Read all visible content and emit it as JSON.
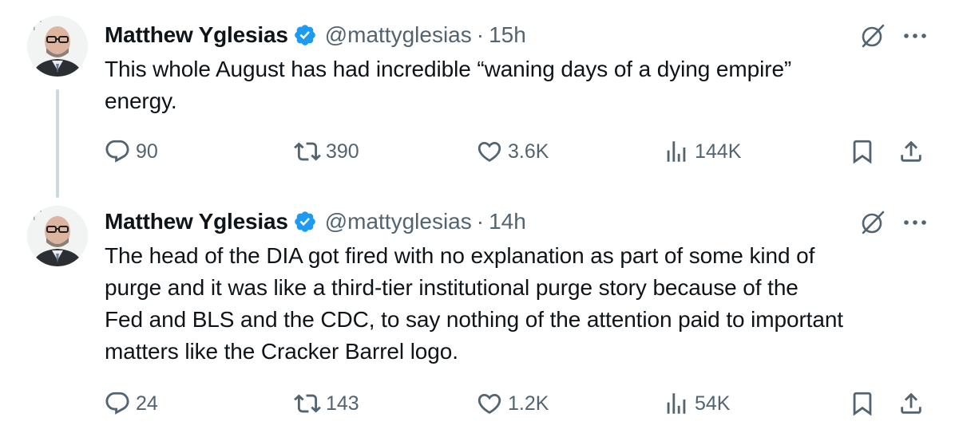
{
  "tweets": [
    {
      "author": {
        "name": "Matthew Yglesias",
        "handle": "@mattyglesias"
      },
      "separator": "·",
      "time": "15h",
      "text_lines": [
        "This whole August has had incredible “waning days of a dying empire”",
        "energy."
      ],
      "stats": {
        "replies": "90",
        "retweets": "390",
        "likes": "3.6K",
        "views": "144K"
      }
    },
    {
      "author": {
        "name": "Matthew Yglesias",
        "handle": "@mattyglesias"
      },
      "separator": "·",
      "time": "14h",
      "text_lines": [
        "The head of the DIA got fired with no explanation as part of some kind of",
        "purge and it was like a third-tier institutional purge story because of the",
        "Fed and BLS and the CDC, to say nothing of the attention paid to important",
        "matters like the Cracker Barrel logo."
      ],
      "stats": {
        "replies": "24",
        "retweets": "143",
        "likes": "1.2K",
        "views": "54K"
      }
    }
  ],
  "icons": {
    "verified": "verified-badge-icon",
    "grok": "grok-icon",
    "more": "more-icon",
    "reply": "reply-icon",
    "retweet": "retweet-icon",
    "like": "heart-icon",
    "views": "views-icon",
    "bookmark": "bookmark-icon",
    "share": "share-icon"
  },
  "colors": {
    "text": "#0f1419",
    "secondary": "#536471",
    "verified": "#1d9bf0",
    "thread_line": "#cfd9de"
  }
}
